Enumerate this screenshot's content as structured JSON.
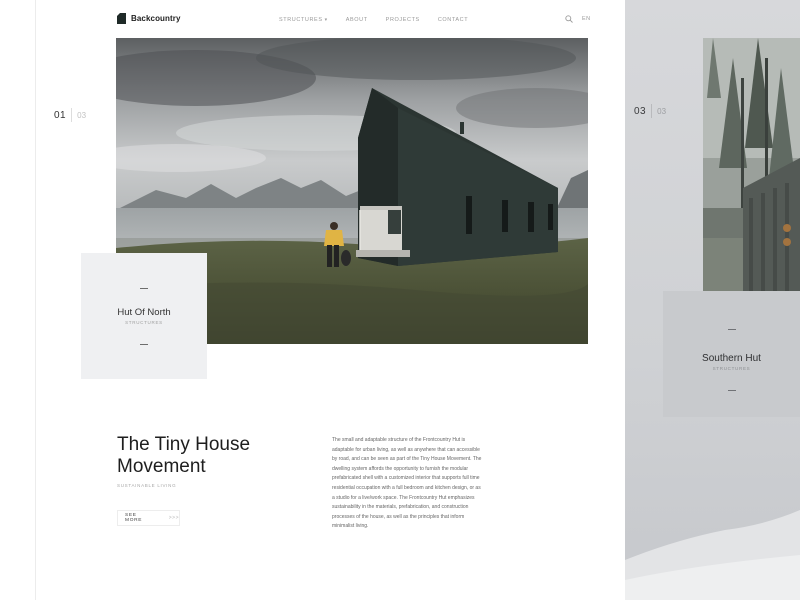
{
  "brand": {
    "name": "Backcountry",
    "logo_icon": "house-logo-icon"
  },
  "nav": {
    "items": [
      {
        "label": "STRUCTURES",
        "has_dropdown": true
      },
      {
        "label": "ABOUT"
      },
      {
        "label": "PROJECTS"
      },
      {
        "label": "CONTACT"
      }
    ],
    "language": "EN",
    "search_icon": "search-icon"
  },
  "slider": {
    "current": "01",
    "total": "03",
    "caption_title": "Hut Of North",
    "caption_subtitle": "STRUCTURES"
  },
  "next_slide": {
    "current": "03",
    "total": "03",
    "caption_title": "Southern Hut",
    "caption_subtitle": "STRUCTURES"
  },
  "article": {
    "headline": "The Tiny House Movement",
    "subtitle": "SUSTAINABLE LIVING",
    "cta_label": "SEE MORE",
    "cta_arrow": ">>>",
    "body": "The small and adaptable structure of the Frontcountry Hut is adaptable for urban living, as well as anywhere that can accessible by road, and can be seen as part of the Tiny House Movement. The dwelling system affords the opportunity to furnish the modular prefabricated shell with a customized interior that supports full time residential occupation with a full bedroom and kitchen design, or as a studio for a live/work space. The Frontcountry Hut emphasizes sustainability in the materials, prefabrication, and construction processes of the house, as well as the principles that inform minimalist living."
  },
  "colors": {
    "accent_dark": "#1e1e1e",
    "card_bg": "#eff0f2",
    "next_panel_bg": "#d2d4d7",
    "hut_color": "#2b3532",
    "jacket_color": "#e0b444"
  }
}
